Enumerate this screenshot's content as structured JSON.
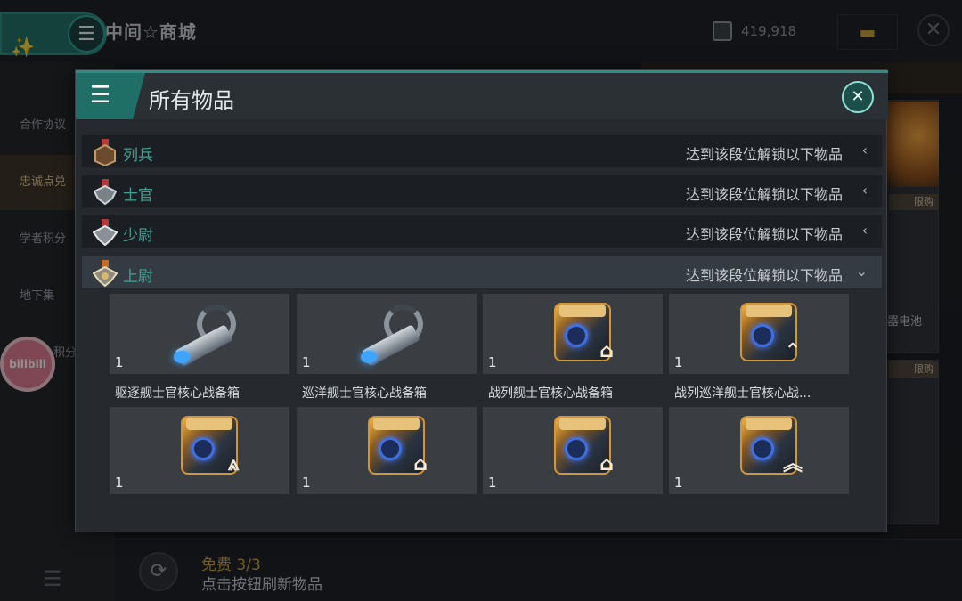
{
  "header": {
    "shop_title": "中间☆商城",
    "currency_value": "419,918",
    "party_icon": "party-popper-icon",
    "menu_icon": "hamburger-icon",
    "ticket_icon": "ticket-icon",
    "close_icon": "close-icon"
  },
  "sidebar": {
    "items": [
      {
        "label": "合作协议",
        "active": false
      },
      {
        "label": "忠诚点兑",
        "active": true
      },
      {
        "label": "学者积分",
        "active": false
      },
      {
        "label": "地下集",
        "active": false
      },
      {
        "label": "积分",
        "active": false
      }
    ],
    "bilibili_label": "bilibili"
  },
  "shop": {
    "limit_tag": "限购",
    "battery_label": "器电池"
  },
  "footer": {
    "free_label": "免费 3/3",
    "refresh_hint": "点击按钮刷新物品"
  },
  "modal": {
    "title": "所有物品",
    "ranks": [
      {
        "name": "列兵",
        "hint": "达到该段位解锁以下物品",
        "expanded": false,
        "arrow": "‹"
      },
      {
        "name": "士官",
        "hint": "达到该段位解锁以下物品",
        "expanded": false,
        "arrow": "‹"
      },
      {
        "name": "少尉",
        "hint": "达到该段位解锁以下物品",
        "expanded": false,
        "arrow": "‹"
      },
      {
        "name": "上尉",
        "hint": "达到该段位解锁以下物品",
        "expanded": true,
        "arrow": "⌄"
      }
    ],
    "items_row1": [
      {
        "name": "驱逐舰士官核心战备箱",
        "qty": "1",
        "art": "cannon"
      },
      {
        "name": "巡洋舰士官核心战备箱",
        "qty": "1",
        "art": "cannon"
      },
      {
        "name": "战列舰士官核心战备箱",
        "qty": "1",
        "art": "chest"
      },
      {
        "name": "战列巡洋舰士官核心战...",
        "qty": "1",
        "art": "chest"
      }
    ],
    "items_row2": [
      {
        "qty": "1",
        "art": "chest",
        "mark": "⩓"
      },
      {
        "qty": "1",
        "art": "chest",
        "mark": "⌂"
      },
      {
        "qty": "1",
        "art": "chest",
        "mark": "⌂"
      },
      {
        "qty": "1",
        "art": "chest",
        "mark": "︽"
      }
    ]
  }
}
